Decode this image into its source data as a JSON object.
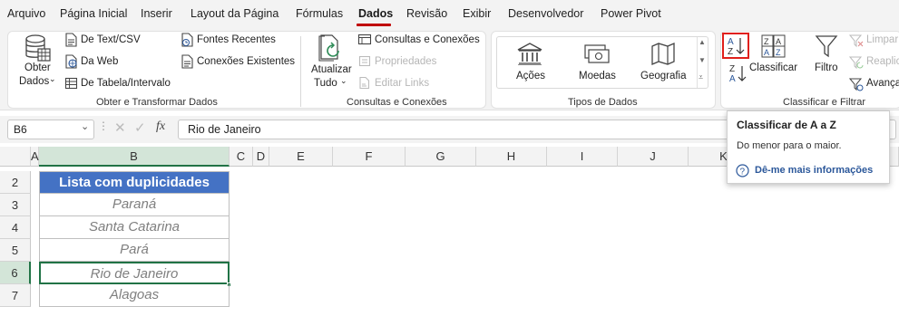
{
  "menu": {
    "items": [
      "Arquivo",
      "Página Inicial",
      "Inserir",
      "Layout da Página",
      "Fórmulas",
      "Dados",
      "Revisão",
      "Exibir",
      "Desenvolvedor",
      "Power Pivot"
    ],
    "active": "Dados"
  },
  "ribbon": {
    "obter": {
      "get_data_line1": "Obter",
      "get_data_line2": "Dados",
      "from_text_csv": "De Text/CSV",
      "from_web": "Da Web",
      "from_table": "De Tabela/Intervalo",
      "recent_sources": "Fontes Recentes",
      "existing_connections": "Conexões Existentes",
      "group_label": "Obter e Transformar Dados"
    },
    "consultas": {
      "refresh_line1": "Atualizar",
      "refresh_line2": "Tudo",
      "queries_connections": "Consultas e Conexões",
      "properties": "Propriedades",
      "edit_links": "Editar Links",
      "group_label": "Consultas e Conexões"
    },
    "tipos": {
      "stocks": "Ações",
      "currencies": "Moedas",
      "geography": "Geografia",
      "group_label": "Tipos de Dados"
    },
    "classificar": {
      "sort_az": "A Z",
      "sort_za": "Z A",
      "sort": "Classificar",
      "filter": "Filtro",
      "clear": "Limpar",
      "reapply": "Reaplicar",
      "advanced": "Avançado",
      "group_label": "Classificar e Filtrar"
    }
  },
  "formula_bar": {
    "name_box": "B6",
    "fx_symbol": "fx",
    "value": "Rio de Janeiro"
  },
  "grid": {
    "columns": [
      "A",
      "B",
      "C",
      "D",
      "E",
      "F",
      "G",
      "H",
      "I",
      "J",
      "K"
    ],
    "rows": [
      "2",
      "3",
      "4",
      "5",
      "6",
      "7"
    ],
    "header_cell": "Lista com duplicidades",
    "values": [
      "Paraná",
      "Santa Catarina",
      "Pará",
      "Rio de Janeiro",
      "Alagoas"
    ],
    "selected_cell": "B6"
  },
  "tooltip": {
    "title": "Classificar de A a Z",
    "description": "Do menor para o maior.",
    "link": "Dê-me mais informações"
  },
  "colors": {
    "accent": "#c00000",
    "header_fill": "#4472c4",
    "selection": "#217346",
    "link": "#2b579a"
  }
}
